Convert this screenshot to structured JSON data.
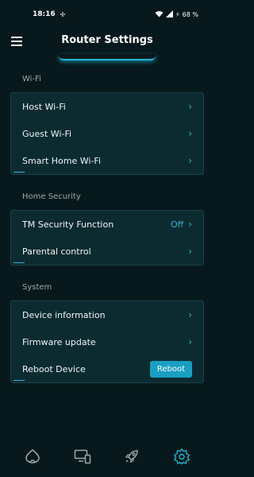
{
  "status_bar": {
    "time": "18:16",
    "battery": "68 %"
  },
  "header": {
    "title": "Router Settings"
  },
  "sections": {
    "wifi": {
      "label": "Wi-Fi",
      "items": [
        {
          "label": "Host Wi-Fi"
        },
        {
          "label": "Guest Wi-Fi"
        },
        {
          "label": "Smart Home Wi-Fi"
        }
      ]
    },
    "home_security": {
      "label": "Home Security",
      "items": [
        {
          "label": "TM Security Function",
          "value": "Off"
        },
        {
          "label": "Parental control"
        }
      ]
    },
    "system": {
      "label": "System",
      "items": [
        {
          "label": "Device information"
        },
        {
          "label": "Firmware update"
        },
        {
          "label": "Reboot Device",
          "button": "Reboot"
        }
      ]
    }
  },
  "bottom_nav": {
    "items": [
      {
        "icon": "home-icon",
        "active": false
      },
      {
        "icon": "devices-icon",
        "active": false
      },
      {
        "icon": "rocket-icon",
        "active": false
      },
      {
        "icon": "settings-icon",
        "active": true
      }
    ]
  },
  "colors": {
    "background": "#07191c",
    "card": "#0c2b31",
    "accent": "#1fb6d6",
    "button": "#1a9fc2"
  }
}
